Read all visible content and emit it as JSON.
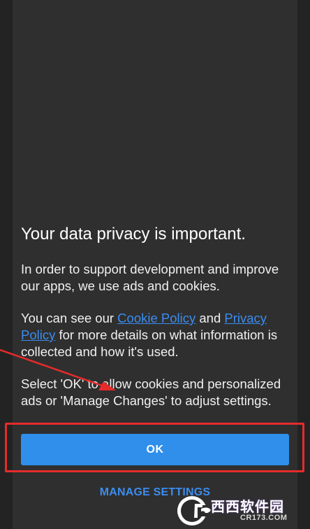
{
  "dialog": {
    "title": "Your data privacy is important.",
    "paragraph1": "In order to support development and improve our apps, we use ads and cookies.",
    "paragraph2_before": "You can see our ",
    "cookie_policy_link": "Cookie Policy",
    "paragraph2_middle": " and ",
    "privacy_policy_link": "Privacy Policy",
    "paragraph2_after": " for more details on what information is collected and how it's used.",
    "paragraph3": "Select 'OK' to allow cookies and personalized ads or 'Manage Changes' to adjust settings.",
    "ok_label": "OK",
    "manage_label": "MANAGE SETTINGS"
  },
  "colors": {
    "background": "#232323",
    "dialog": "#2f2f2f",
    "accent": "#2f8fea",
    "link": "#3b8df0",
    "annotation": "#e52b2b"
  },
  "watermark": {
    "brand": "西西软件园",
    "domain": "CR173.COM",
    "icon": "cr-logo-icon"
  }
}
